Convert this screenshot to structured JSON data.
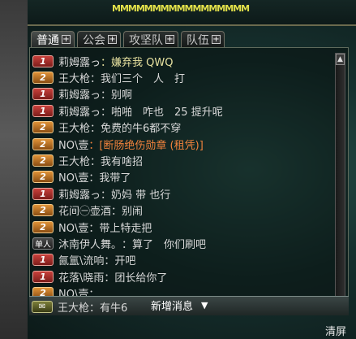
{
  "top_text": "MMMMMMMMMMMMMMMMM",
  "tabs": [
    {
      "label": "普通",
      "active": true
    },
    {
      "label": "公会",
      "active": false
    },
    {
      "label": "攻坚队",
      "active": false
    },
    {
      "label": "队伍",
      "active": false
    }
  ],
  "messages": [
    {
      "badge": "1",
      "kind": "b1",
      "sender": "莉姆露っ",
      "text": "：嫌弃我 QWQ",
      "color": "yellow"
    },
    {
      "badge": "2",
      "kind": "b2",
      "sender": "王大枪",
      "text": "：我们三个　人　打",
      "color": ""
    },
    {
      "badge": "1",
      "kind": "b1",
      "sender": "莉姆露っ",
      "text": "：别啊",
      "color": ""
    },
    {
      "badge": "1",
      "kind": "b1",
      "sender": "莉姆露っ",
      "text": "：啪啪　咋也　25 提升呢",
      "color": ""
    },
    {
      "badge": "2",
      "kind": "b2",
      "sender": "王大枪",
      "text": "：免费的牛6都不穿",
      "color": ""
    },
    {
      "badge": "2",
      "kind": "b2",
      "sender": "NO\\壹",
      "text": "：[断肠绝伤勋章 (租凭)]",
      "color": "orange"
    },
    {
      "badge": "2",
      "kind": "b2",
      "sender": "王大枪",
      "text": "：我有啥招",
      "color": ""
    },
    {
      "badge": "2",
      "kind": "b2",
      "sender": "NO\\壹",
      "text": "：我带了",
      "color": ""
    },
    {
      "badge": "1",
      "kind": "b1",
      "sender": "莉姆露っ",
      "text": "：奶妈 带 也行",
      "color": ""
    },
    {
      "badge": "2",
      "kind": "b2",
      "sender": "花间㊀壶酒",
      "text": "：别闹",
      "color": ""
    },
    {
      "badge": "2",
      "kind": "b2",
      "sender": "NO\\壹",
      "text": "：带上特走把",
      "color": ""
    },
    {
      "badge": "单人",
      "kind": "single",
      "sender": "沐南伊人舞。",
      "text": "：算了　你们刷吧",
      "color": ""
    },
    {
      "badge": "1",
      "kind": "b1",
      "sender": "氤氲\\流响",
      "text": "：开吧",
      "color": ""
    },
    {
      "badge": "1",
      "kind": "b1",
      "sender": "花落\\晓雨",
      "text": "：团长给你了",
      "color": ""
    },
    {
      "badge": "2",
      "kind": "b2",
      "sender": "NO\\壹",
      "text": "：...",
      "color": ""
    }
  ],
  "last_message": {
    "badge": "✉",
    "sender": "王大枪",
    "text": "：有牛6"
  },
  "new_message_label": "新增消息",
  "new_message_arrow": "▼",
  "scroll_up": "▲",
  "scroll_down": "▼",
  "clear_label": "清屏"
}
